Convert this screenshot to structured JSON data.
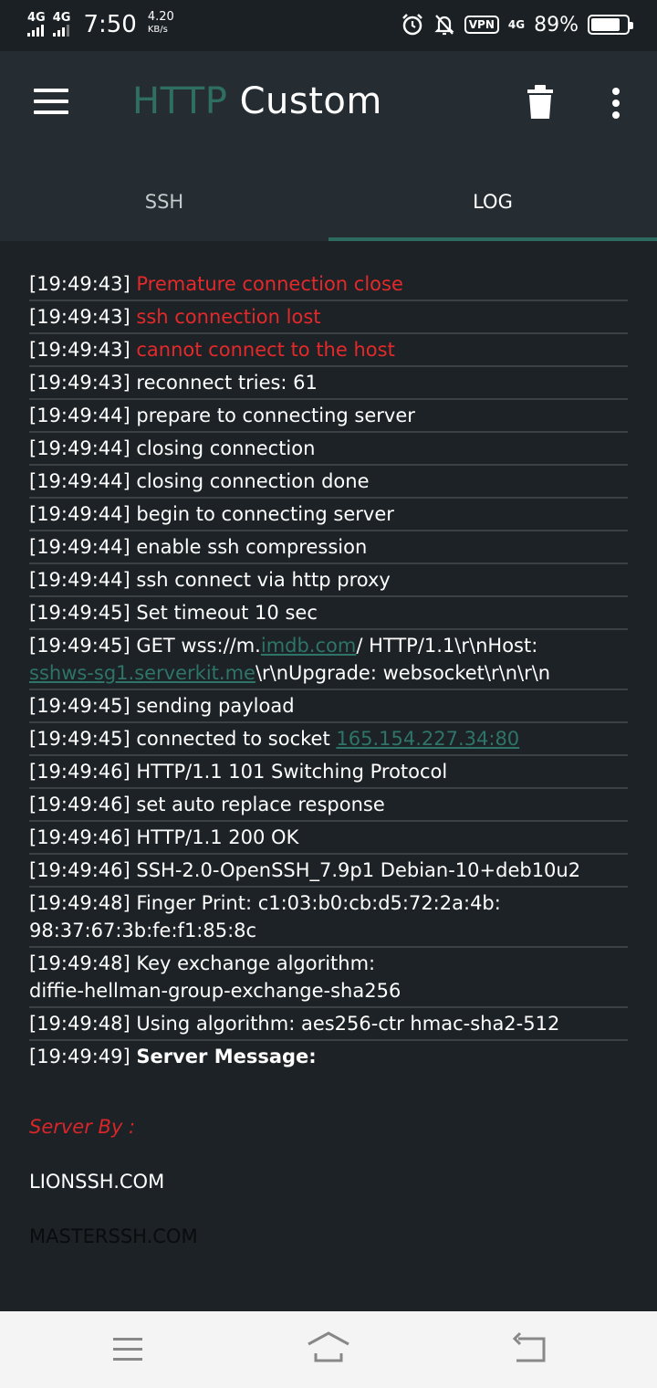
{
  "status_bar": {
    "sim1": "4G",
    "sim2": "4G",
    "time": "7:50",
    "net_speed_value": "4.20",
    "net_speed_unit": "KB/s",
    "vpn": "VPN",
    "lte": "4G",
    "battery_pct": "89%",
    "battery_level": 0.89
  },
  "app_bar": {
    "title_part1": "HTTP",
    "title_part2": "Custom"
  },
  "tabs": [
    {
      "label": "SSH",
      "active": false
    },
    {
      "label": "LOG",
      "active": true
    }
  ],
  "log": [
    {
      "time": "[19:49:43]",
      "msg": "Premature connection close"
    },
    {
      "time": "[19:49:43]",
      "msg": "ssh connection lost"
    },
    {
      "time": "[19:49:43]",
      "msg": "cannot connect to the host"
    },
    {
      "time": "[19:49:43]",
      "msg": "reconnect tries: 61"
    },
    {
      "time": "[19:49:44]",
      "msg": "prepare to connecting server"
    },
    {
      "time": "[19:49:44]",
      "msg": "closing connection"
    },
    {
      "time": "[19:49:44]",
      "msg": "closing connection done"
    },
    {
      "time": "[19:49:44]",
      "msg": "begin to connecting server"
    },
    {
      "time": "[19:49:44]",
      "msg": "enable ssh compression"
    },
    {
      "time": "[19:49:44]",
      "msg": "ssh connect via http proxy"
    },
    {
      "time": "[19:49:45]",
      "msg": "Set timeout 10 sec"
    },
    {
      "time": "[19:49:45]",
      "msg_a": "GET wss://m.",
      "link_a": "imdb.com",
      "msg_b": "/ HTTP/1.1\\r\\nHost:",
      "link_b": "sshws-sg1.serverkit.me",
      "msg_c": "\\r\\nUpgrade: websocket\\r\\n\\r\\n"
    },
    {
      "time": "[19:49:45]",
      "msg": "sending payload"
    },
    {
      "time": "[19:49:45]",
      "msg": "connected to socket ",
      "link": "165.154.227.34:80"
    },
    {
      "time": "[19:49:46]",
      "msg": "HTTP/1.1 101 Switching Protocol"
    },
    {
      "time": "[19:49:46]",
      "msg": "set auto replace response"
    },
    {
      "time": "[19:49:46]",
      "msg": "HTTP/1.1 200 OK"
    },
    {
      "time": "[19:49:46]",
      "msg": "SSH-2.0-OpenSSH_7.9p1 Debian-10+deb10u2"
    },
    {
      "time": "[19:49:48]",
      "msg": "Finger Print: c1:03:b0:cb:d5:72:2a:4b:",
      "msg2": "98:37:67:3b:fe:f1:85:8c"
    },
    {
      "time": "[19:49:48]",
      "msg": "Key exchange algorithm:",
      "msg2": "diffie-hellman-group-exchange-sha256"
    },
    {
      "time": "[19:49:48]",
      "msg": "Using algorithm: aes256-ctr hmac-sha2-512"
    },
    {
      "time": "[19:49:49]",
      "msg": "Server Message:"
    }
  ],
  "server_message": {
    "server_by": "Server By :",
    "server1": "LIONSSH.COM",
    "server2": "MASTERSSH.COM"
  },
  "colors": {
    "error": "#e5292a",
    "link": "#2e7468",
    "accent": "#2d6b60"
  }
}
